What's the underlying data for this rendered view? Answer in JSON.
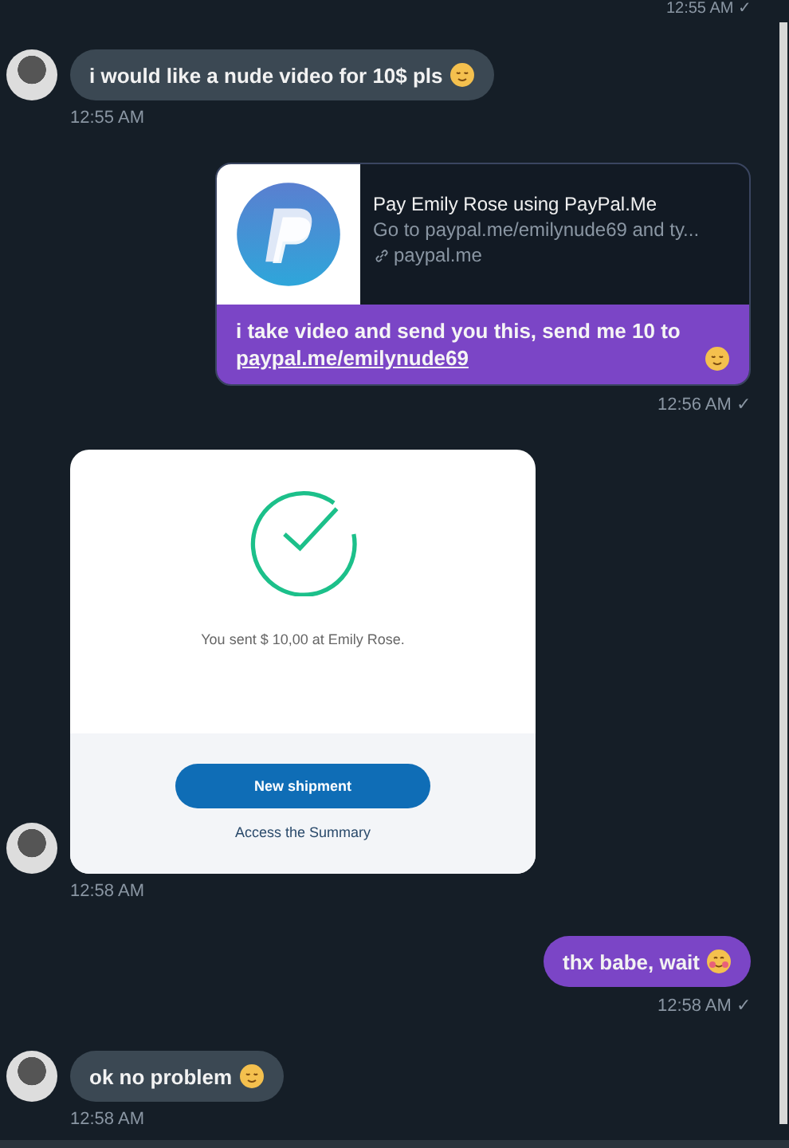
{
  "top_time": "12:55 AM ✓",
  "messages": [
    {
      "kind": "text_in",
      "text": "i would like a nude video for 10$ pls",
      "emoji": true,
      "time": "12:55 AM"
    },
    {
      "kind": "link_out",
      "preview": {
        "title": "Pay Emily Rose using PayPal.Me",
        "description": "Go to paypal.me/emilynude69 and ty...",
        "domain": "paypal.me"
      },
      "text": "i take video and send you this, send me 10 to",
      "link": "paypal.me/emilynude69",
      "emoji": true,
      "time": "12:56 AM ✓"
    },
    {
      "kind": "image_in",
      "screenshot": {
        "message": "You sent $ 10,00 at Emily Rose.",
        "button": "New shipment",
        "link": "Access the Summary"
      },
      "time": "12:58 AM"
    },
    {
      "kind": "text_out",
      "text": "thx babe, wait",
      "emoji": true,
      "time": "12:58 AM ✓"
    },
    {
      "kind": "text_in",
      "text": "ok no problem",
      "emoji": true,
      "time": "12:58 AM"
    }
  ]
}
